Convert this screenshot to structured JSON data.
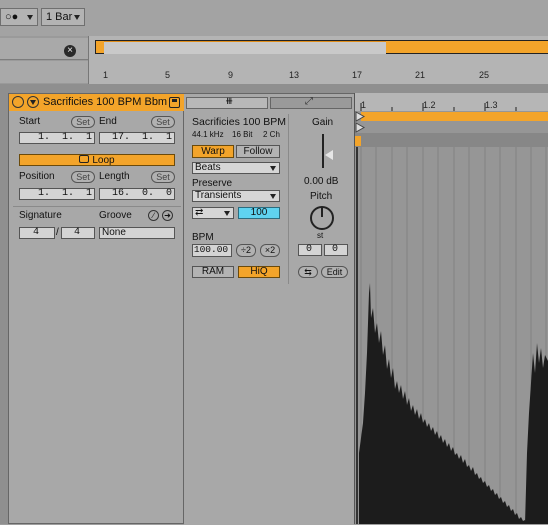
{
  "topbar": {
    "quantize_icon": "○●",
    "grid_value": "1 Bar"
  },
  "overview": {
    "ruler": [
      "1",
      "5",
      "9",
      "13",
      "17",
      "21",
      "25"
    ]
  },
  "clip": {
    "name": "Sacrificies 100 BPM Bbm",
    "start_label": "Start",
    "end_label": "End",
    "set_label": "Set",
    "start_value": "1.  1.  1",
    "end_value": "17.  1.  1",
    "loop_label": "Loop",
    "position_label": "Position",
    "length_label": "Length",
    "position_value": "1.  1.  1",
    "length_value": "16.  0.  0",
    "signature_label": "Signature",
    "groove_label": "Groove",
    "sig_num": "4",
    "sig_sep": "/",
    "sig_den": "4",
    "groove_value": "None"
  },
  "sample": {
    "name": "Sacrificies 100 BPM",
    "rate": "44.1 kHz",
    "bits": "16 Bit",
    "channels": "2 Ch",
    "warp_label": "Warp",
    "follow_label": "Follow",
    "mode": "Beats",
    "preserve_label": "Preserve",
    "preserve_value": "Transients",
    "loop_mode_icon": "⇄",
    "transient_value": "100",
    "bpm_label": "BPM",
    "bpm_value": "100.00",
    "half_label": "÷2",
    "double_label": "×2",
    "ram_label": "RAM",
    "hiq_label": "HiQ",
    "gain_label": "Gain",
    "gain_value": "0.00 dB",
    "pitch_label": "Pitch",
    "pitch_unit": "st",
    "pitch_st": "0",
    "pitch_cents": "0",
    "reverse_icon": "⇆",
    "edit_label": "Edit"
  },
  "waveform": {
    "ruler": [
      "1",
      "1.2",
      "1.3"
    ]
  },
  "colors": {
    "accent": "#f3a42a",
    "transient_field": "#5fd3f0"
  }
}
